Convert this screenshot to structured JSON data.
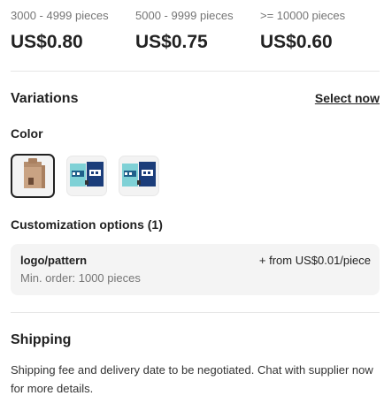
{
  "price_tiers": [
    {
      "range": "3000 - 4999 pieces",
      "price": "US$0.80"
    },
    {
      "range": "5000 - 9999 pieces",
      "price": "US$0.75"
    },
    {
      "range": ">= 10000 pieces",
      "price": "US$0.60"
    }
  ],
  "variations": {
    "title": "Variations",
    "select_label": "Select now",
    "color_label": "Color",
    "swatches": [
      {
        "icon": "kraft-bag-in-box-icon",
        "selected": true
      },
      {
        "icon": "printed-bag-in-box-icon",
        "selected": false
      },
      {
        "icon": "printed-bag-in-box-icon",
        "selected": false
      }
    ]
  },
  "customization": {
    "title": "Customization options (1)",
    "options": [
      {
        "name": "logo/pattern",
        "price": "+ from US$0.01/piece",
        "min_order": "Min. order: 1000 pieces"
      }
    ]
  },
  "shipping": {
    "title": "Shipping",
    "text": "Shipping fee and delivery date to be negotiated. Chat with supplier now for more details."
  },
  "colors": {
    "selected_border": "#222222",
    "muted_text": "#767676",
    "box_bg": "#f4f4f4"
  }
}
